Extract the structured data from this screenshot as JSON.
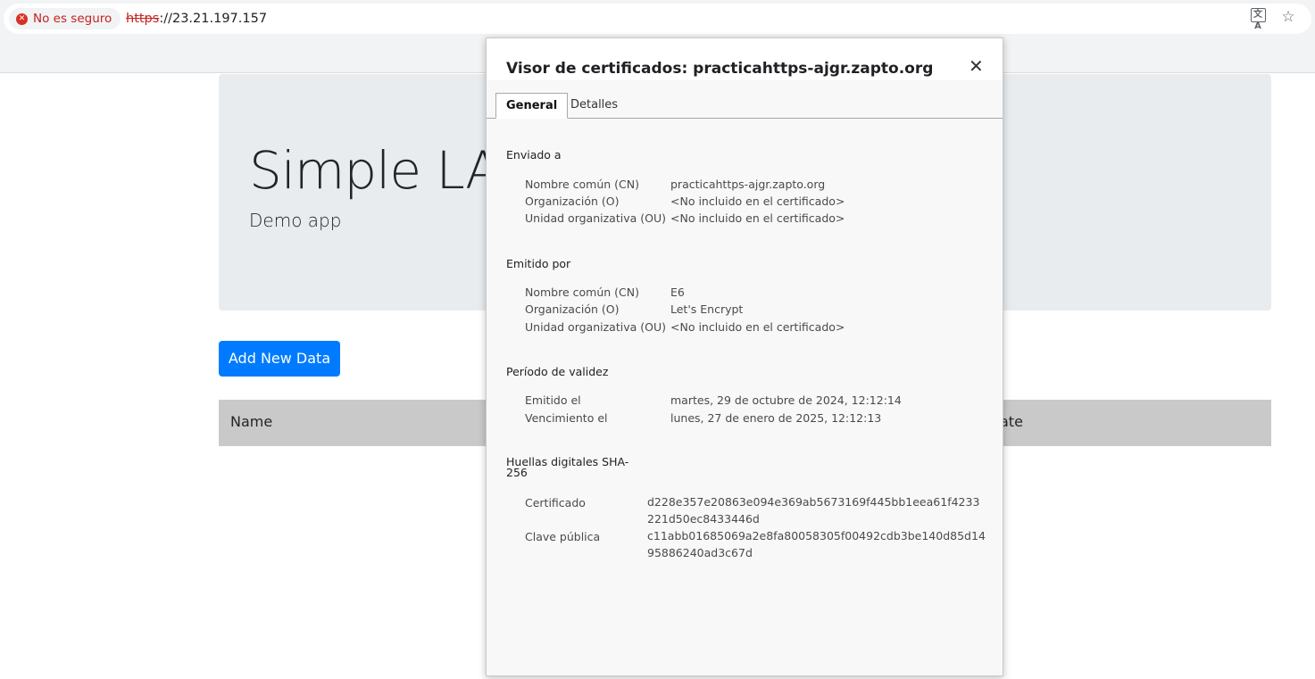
{
  "browser": {
    "security_chip": "No es seguro",
    "url_protocol": "https",
    "url_rest": "://23.21.197.157",
    "translate_icon": "translate-icon",
    "star_icon": "bookmark-star-icon"
  },
  "page": {
    "title": "Simple LAN",
    "subtitle": "Demo app",
    "add_button": "Add New Data",
    "table_headers": [
      "Name",
      "ate"
    ]
  },
  "dialog": {
    "title": "Visor de certificados: practicahttps-ajgr.zapto.org",
    "close_glyph": "✕",
    "tabs": [
      "General",
      "Detalles"
    ],
    "issued_to": {
      "heading": "Enviado a",
      "rows": [
        {
          "label": "Nombre común (CN)",
          "value": "practicahttps-ajgr.zapto.org"
        },
        {
          "label": "Organización (O)",
          "value": "<No incluido en el certificado>"
        },
        {
          "label": "Unidad organizativa (OU)",
          "value": "<No incluido en el certificado>"
        }
      ]
    },
    "issued_by": {
      "heading": "Emitido por",
      "rows": [
        {
          "label": "Nombre común (CN)",
          "value": "E6"
        },
        {
          "label": "Organización (O)",
          "value": "Let's Encrypt"
        },
        {
          "label": "Unidad organizativa (OU)",
          "value": "<No incluido en el certificado>"
        }
      ]
    },
    "validity": {
      "heading": "Período de validez",
      "rows": [
        {
          "label": "Emitido el",
          "value": "martes, 29 de octubre de 2024, 12:12:14"
        },
        {
          "label": "Vencimiento el",
          "value": "lunes, 27 de enero de 2025, 12:12:13"
        }
      ]
    },
    "fingerprints": {
      "heading_line1": "Huellas digitales SHA-",
      "heading_line2": "256",
      "rows": [
        {
          "label": "Certificado",
          "value": "d228e357e20863e094e369ab5673169f445bb1eea61f4233221d50ec8433446d"
        },
        {
          "label": "Clave pública",
          "value": "c11abb01685069a2e8fa80058305f00492cdb3be140d85d1495886240ad3c67d"
        }
      ]
    }
  }
}
